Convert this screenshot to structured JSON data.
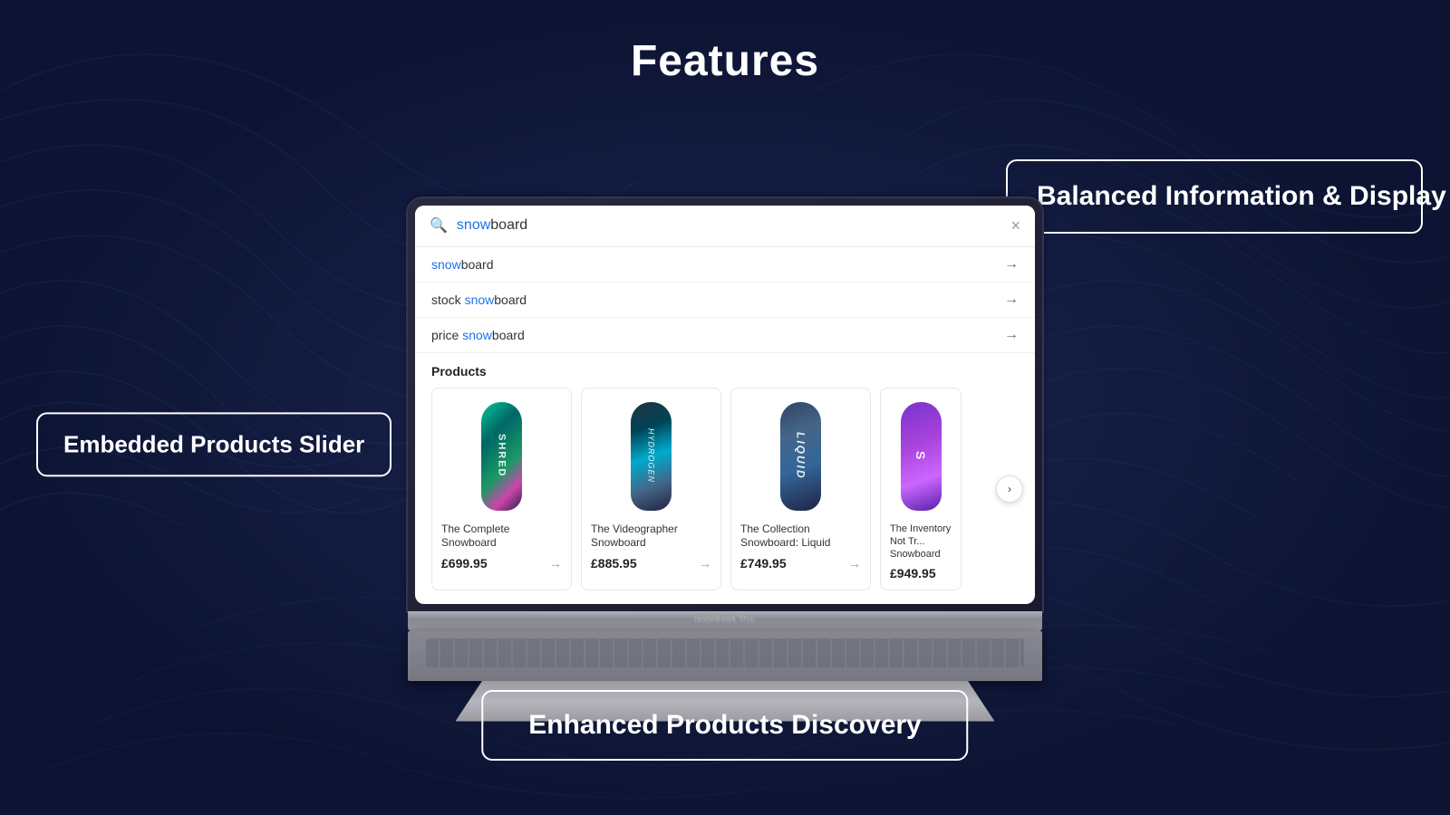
{
  "page": {
    "title": "Features",
    "background_color": "#0d1433"
  },
  "labels": {
    "left": "Embedded Products Slider",
    "right": "Balanced Information & Display",
    "bottom": "Enhanced Products Discovery"
  },
  "search": {
    "query": "snowboard",
    "query_highlight": "snow",
    "query_rest": "board",
    "placeholder": "snowboard",
    "close_label": "×"
  },
  "suggestions": [
    {
      "prefix": "",
      "highlight": "snow",
      "rest": "board",
      "full": "snowboard"
    },
    {
      "prefix": "stock ",
      "highlight": "snow",
      "rest": "board",
      "full": "stock snowboard"
    },
    {
      "prefix": "price ",
      "highlight": "snow",
      "rest": "board",
      "full": "price snowboard"
    }
  ],
  "products_section": {
    "label": "Products",
    "slider_next_label": "›"
  },
  "products": [
    {
      "name": "The Complete Snowboard",
      "price": "£699.95",
      "color_class": "sb-complete",
      "board_text": "SHRED"
    },
    {
      "name": "The Videographer Snowboard",
      "price": "£885.95",
      "color_class": "sb-videographer",
      "board_text": "Hydrogen"
    },
    {
      "name": "The Collection Snowboard: Liquid",
      "price": "£749.95",
      "color_class": "sb-collection",
      "board_text": "liquid"
    },
    {
      "name": "The Inventory Not Tr... Snowboard",
      "price": "£949.95",
      "color_class": "sb-inventory",
      "board_text": "S"
    }
  ]
}
